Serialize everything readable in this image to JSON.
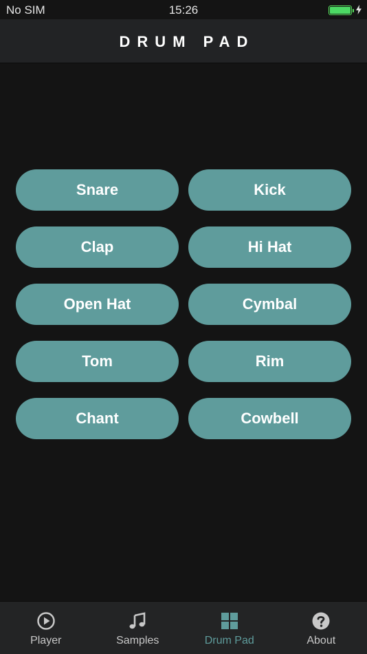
{
  "status_bar": {
    "carrier": "No SIM",
    "time": "15:26",
    "battery_level": 1.0,
    "charging": true
  },
  "nav": {
    "title": "DRUM PAD"
  },
  "pads": [
    {
      "label": "Snare"
    },
    {
      "label": "Kick"
    },
    {
      "label": "Clap"
    },
    {
      "label": "Hi Hat"
    },
    {
      "label": "Open Hat"
    },
    {
      "label": "Cymbal"
    },
    {
      "label": "Tom"
    },
    {
      "label": "Rim"
    },
    {
      "label": "Chant"
    },
    {
      "label": "Cowbell"
    }
  ],
  "tabs": [
    {
      "label": "Player",
      "icon": "play-circle-icon",
      "active": false
    },
    {
      "label": "Samples",
      "icon": "music-note-icon",
      "active": false
    },
    {
      "label": "Drum Pad",
      "icon": "grid-icon",
      "active": true
    },
    {
      "label": "About",
      "icon": "question-circle-icon",
      "active": false
    }
  ],
  "colors": {
    "accent": "#5f9c9c",
    "background": "#141414",
    "bar": "#232425",
    "battery": "#4cd964"
  }
}
